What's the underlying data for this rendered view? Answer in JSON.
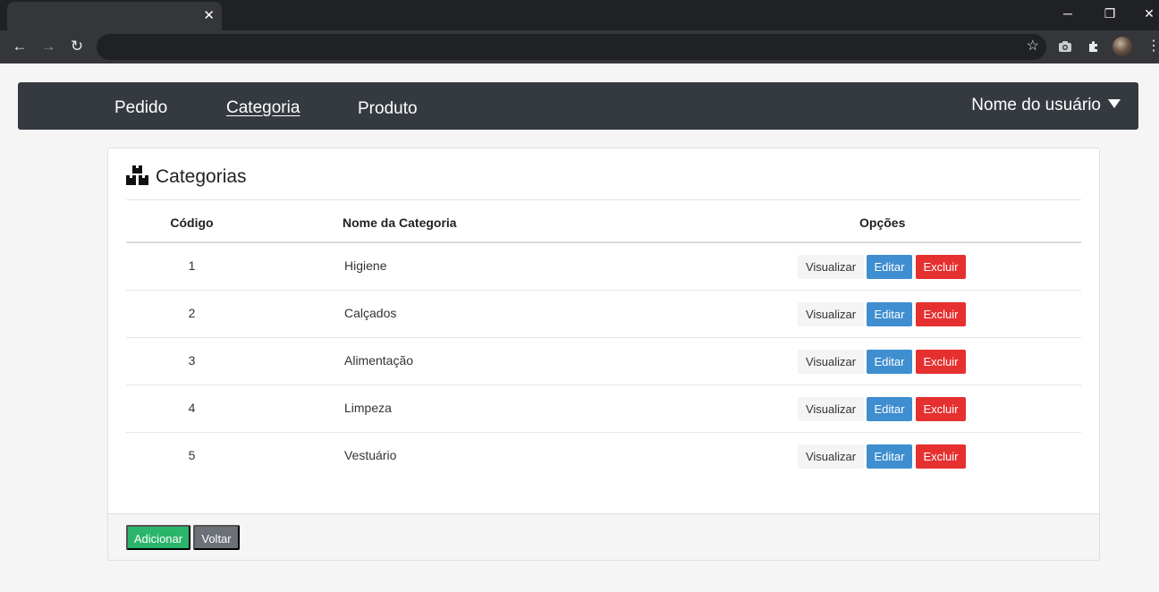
{
  "browser": {
    "tab_close": "✕",
    "window_controls": {
      "minimize": "─",
      "restore": "❐",
      "close": "✕"
    },
    "nav": {
      "back": "←",
      "forward": "→",
      "reload": "↻"
    },
    "icons": [
      "star-icon",
      "camera-icon",
      "puzzle-icon",
      "avatar",
      "kebab-menu-icon"
    ]
  },
  "navbar": {
    "links": [
      {
        "label": "Pedido"
      },
      {
        "label": "Categoria",
        "active": true
      },
      {
        "label": "Produto"
      }
    ],
    "user_label": "Nome do usuário"
  },
  "card": {
    "title": "Categorias",
    "columns": {
      "code": "Código",
      "name": "Nome da Categoria",
      "options": "Opções"
    },
    "rows": [
      {
        "code": "1",
        "name": "Higiene"
      },
      {
        "code": "2",
        "name": "Calçados"
      },
      {
        "code": "3",
        "name": "Alimentação"
      },
      {
        "code": "4",
        "name": "Limpeza"
      },
      {
        "code": "5",
        "name": "Vestuário"
      }
    ],
    "row_actions": {
      "view": "Visualizar",
      "edit": "Editar",
      "delete": "Excluir"
    },
    "footer": {
      "add": "Adicionar",
      "back": "Voltar"
    }
  },
  "colors": {
    "navbar_bg": "#343a40",
    "edit": "#3e8ed0",
    "delete": "#e63030",
    "add": "#2ab56a",
    "back": "#6c7077"
  }
}
